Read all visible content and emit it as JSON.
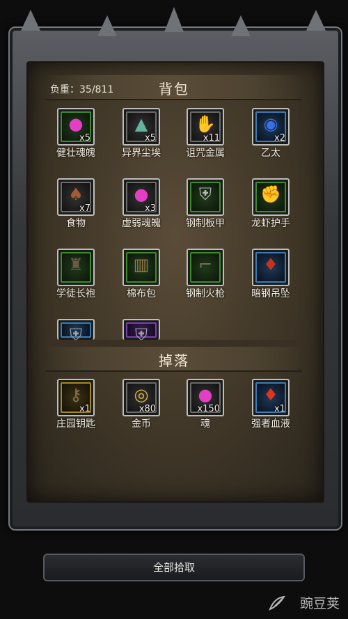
{
  "inventory": {
    "weight_label": "负重：35/811",
    "title": "背包",
    "items": [
      {
        "name": "健壮魂魄",
        "qty": "x5",
        "icon": "pink-soul-icon",
        "rarity": "green"
      },
      {
        "name": "异界尘埃",
        "qty": "x5",
        "icon": "dust-pile-icon",
        "rarity": "gray"
      },
      {
        "name": "诅咒金属",
        "qty": "x11",
        "icon": "metal-ore-icon",
        "rarity": "gray"
      },
      {
        "name": "乙太",
        "qty": "x2",
        "icon": "blue-orb-icon",
        "rarity": "blue"
      },
      {
        "name": "食物",
        "qty": "x7",
        "icon": "meat-icon",
        "rarity": "gray"
      },
      {
        "name": "虚弱魂魄",
        "qty": "x3",
        "icon": "pink-soul-icon",
        "rarity": "gray"
      },
      {
        "name": "钢制板甲",
        "qty": "",
        "icon": "plate-armor-icon",
        "rarity": "green"
      },
      {
        "name": "龙虾护手",
        "qty": "",
        "icon": "gauntlet-icon",
        "rarity": "green"
      },
      {
        "name": "学徒长袍",
        "qty": "",
        "icon": "robe-icon",
        "rarity": "green"
      },
      {
        "name": "棉布包",
        "qty": "",
        "icon": "cloth-bag-icon",
        "rarity": "green"
      },
      {
        "name": "钢制火枪",
        "qty": "",
        "icon": "musket-icon",
        "rarity": "green"
      },
      {
        "name": "暗钢吊坠",
        "qty": "",
        "icon": "pendant-icon",
        "rarity": "blue"
      },
      {
        "name": "",
        "qty": "",
        "icon": "armor-icon",
        "rarity": "blue"
      },
      {
        "name": "",
        "qty": "",
        "icon": "armor-icon",
        "rarity": "purple"
      }
    ]
  },
  "drops": {
    "title": "掉落",
    "items": [
      {
        "name": "庄园钥匙",
        "qty": "x1",
        "icon": "key-icon",
        "rarity": "gold"
      },
      {
        "name": "金币",
        "qty": "x80",
        "icon": "gold-coins-icon",
        "rarity": "gray"
      },
      {
        "name": "魂",
        "qty": "x150",
        "icon": "pink-soul-icon",
        "rarity": "gray"
      },
      {
        "name": "强者血液",
        "qty": "x1",
        "icon": "blood-crystal-icon",
        "rarity": "blue"
      }
    ]
  },
  "pickup_all_label": "全部拾取",
  "watermark": "豌豆荚"
}
